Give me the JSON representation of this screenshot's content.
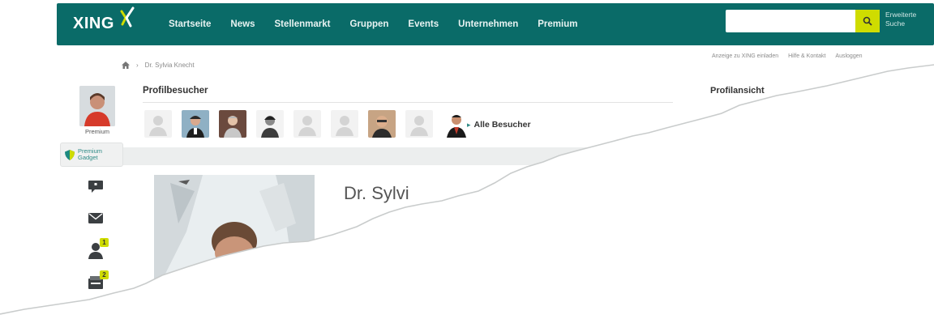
{
  "header": {
    "logo": "XING",
    "nav": [
      "Startseite",
      "News",
      "Stellenmarkt",
      "Gruppen",
      "Events",
      "Unternehmen",
      "Premium"
    ],
    "search": {
      "value": "",
      "placeholder": ""
    },
    "extended_search": "Erweiterte Suche"
  },
  "breadcrumb": {
    "current": "Dr. Sylvia Knecht"
  },
  "top_links": [
    "Anzeige zu XING einladen",
    "Hilfe & Kontakt",
    "Ausloggen"
  ],
  "rail": {
    "account_label": "Premium",
    "gadget_label": "Premium Gadget",
    "badges": {
      "contacts": "1",
      "inbox": "2"
    }
  },
  "visitors": {
    "title": "Profilbesucher",
    "all_label": "Alle Besucher",
    "count_shown": 9
  },
  "profile_view": {
    "title": "Profilansicht"
  },
  "profile": {
    "name_visible": "Dr. Sylvi"
  },
  "colors": {
    "brand": "#0a6b68",
    "accent": "#cfdc00"
  }
}
